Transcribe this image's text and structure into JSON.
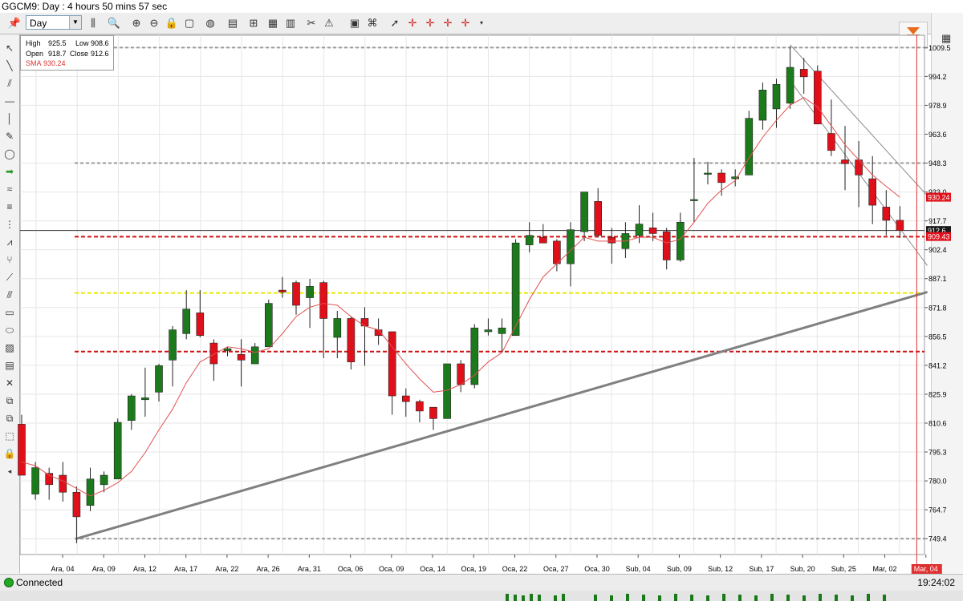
{
  "window": {
    "title": "GGCM9: Day : 4 hours 50 mins 57 sec"
  },
  "toolbar": {
    "period_value": "Day"
  },
  "info": {
    "high_label": "High",
    "high": "925.5",
    "low_label": "Low",
    "low": "908.6",
    "open_label": "Open",
    "open": "918.7",
    "close_label": "Close",
    "close": "912.6",
    "sma_label": "SMA",
    "sma": "930.24"
  },
  "status": {
    "connection": "Connected",
    "time": "19:24:02"
  },
  "colors": {
    "up": "#1c7a1c",
    "down": "#e0101a",
    "sma": "#e05050",
    "trendline": "#808080",
    "hline_yellow": "#e8e800",
    "hline_red": "#d01010"
  },
  "chart_data": {
    "type": "candlestick",
    "symbol": "GGCM9",
    "ylim": [
      741,
      1016
    ],
    "y_ticks": [
      "749.4",
      "764.7",
      "780.0",
      "795.3",
      "810.6",
      "825.9",
      "841.2",
      "856.5",
      "871.8",
      "887.1",
      "902.4",
      "917.7",
      "933.0",
      "948.3",
      "963.6",
      "978.9",
      "994.2",
      "1009.5"
    ],
    "x_labels": [
      "Ara, 04",
      "Ara, 09",
      "Ara, 12",
      "Ara, 17",
      "Ara, 22",
      "Ara, 26",
      "Ara, 31",
      "Oca, 06",
      "Oca, 09",
      "Oca, 14",
      "Oca, 19",
      "Oca, 22",
      "Oca, 27",
      "Oca, 30",
      "Sub, 04",
      "Sub, 09",
      "Sub, 12",
      "Sub, 17",
      "Sub, 20",
      "Sub, 25",
      "Mar, 02",
      "Mar, 04"
    ],
    "candles": [
      {
        "o": 810,
        "h": 815,
        "l": 783,
        "c": 783
      },
      {
        "o": 773,
        "h": 790,
        "l": 770,
        "c": 787
      },
      {
        "o": 784,
        "h": 787,
        "l": 770,
        "c": 778
      },
      {
        "o": 783,
        "h": 790,
        "l": 769,
        "c": 774
      },
      {
        "o": 774,
        "h": 777,
        "l": 747,
        "c": 761
      },
      {
        "o": 767,
        "h": 787,
        "l": 764,
        "c": 781
      },
      {
        "o": 778,
        "h": 785,
        "l": 774,
        "c": 783
      },
      {
        "o": 781,
        "h": 813,
        "l": 781,
        "c": 811
      },
      {
        "o": 812,
        "h": 826,
        "l": 807,
        "c": 825
      },
      {
        "o": 823,
        "h": 840,
        "l": 814,
        "c": 824
      },
      {
        "o": 827,
        "h": 842,
        "l": 822,
        "c": 841
      },
      {
        "o": 844,
        "h": 862,
        "l": 830,
        "c": 860
      },
      {
        "o": 858,
        "h": 881,
        "l": 855,
        "c": 871
      },
      {
        "o": 869,
        "h": 881,
        "l": 856,
        "c": 857
      },
      {
        "o": 853,
        "h": 855,
        "l": 833,
        "c": 842
      },
      {
        "o": 849,
        "h": 851,
        "l": 846,
        "c": 850
      },
      {
        "o": 847,
        "h": 855,
        "l": 830,
        "c": 844
      },
      {
        "o": 842,
        "h": 853,
        "l": 842,
        "c": 851
      },
      {
        "o": 851,
        "h": 876,
        "l": 851,
        "c": 874
      },
      {
        "o": 881,
        "h": 888,
        "l": 877,
        "c": 880
      },
      {
        "o": 885,
        "h": 886,
        "l": 868,
        "c": 873
      },
      {
        "o": 877,
        "h": 887,
        "l": 861,
        "c": 883
      },
      {
        "o": 885,
        "h": 886,
        "l": 845,
        "c": 866
      },
      {
        "o": 856,
        "h": 870,
        "l": 845,
        "c": 866
      },
      {
        "o": 866,
        "h": 867,
        "l": 839,
        "c": 843
      },
      {
        "o": 866,
        "h": 872,
        "l": 841,
        "c": 862
      },
      {
        "o": 860,
        "h": 866,
        "l": 852,
        "c": 857
      },
      {
        "o": 859,
        "h": 859,
        "l": 815,
        "c": 825
      },
      {
        "o": 825,
        "h": 829,
        "l": 814,
        "c": 822
      },
      {
        "o": 822,
        "h": 823,
        "l": 811,
        "c": 817
      },
      {
        "o": 819,
        "h": 819,
        "l": 807,
        "c": 813
      },
      {
        "o": 813,
        "h": 842,
        "l": 813,
        "c": 842
      },
      {
        "o": 842,
        "h": 844,
        "l": 827,
        "c": 831
      },
      {
        "o": 831,
        "h": 863,
        "l": 829,
        "c": 861
      },
      {
        "o": 859,
        "h": 866,
        "l": 857,
        "c": 860
      },
      {
        "o": 858,
        "h": 866,
        "l": 848,
        "c": 861
      },
      {
        "o": 857,
        "h": 908,
        "l": 857,
        "c": 906
      },
      {
        "o": 905,
        "h": 917,
        "l": 901,
        "c": 910
      },
      {
        "o": 909,
        "h": 916,
        "l": 906,
        "c": 906
      },
      {
        "o": 907,
        "h": 908,
        "l": 891,
        "c": 895
      },
      {
        "o": 895,
        "h": 917,
        "l": 883,
        "c": 913
      },
      {
        "o": 912,
        "h": 933,
        "l": 907,
        "c": 933
      },
      {
        "o": 928,
        "h": 935,
        "l": 909,
        "c": 910
      },
      {
        "o": 909,
        "h": 914,
        "l": 895,
        "c": 906
      },
      {
        "o": 903,
        "h": 917,
        "l": 898,
        "c": 911
      },
      {
        "o": 910,
        "h": 926,
        "l": 906,
        "c": 916
      },
      {
        "o": 914,
        "h": 922,
        "l": 907,
        "c": 911
      },
      {
        "o": 912,
        "h": 914,
        "l": 892,
        "c": 897
      },
      {
        "o": 897,
        "h": 922,
        "l": 896,
        "c": 917
      },
      {
        "o": 929,
        "h": 951,
        "l": 917,
        "c": 929
      },
      {
        "o": 943,
        "h": 949,
        "l": 937,
        "c": 943
      },
      {
        "o": 943,
        "h": 945,
        "l": 931,
        "c": 938
      },
      {
        "o": 940,
        "h": 945,
        "l": 936,
        "c": 941
      },
      {
        "o": 942,
        "h": 976,
        "l": 942,
        "c": 972
      },
      {
        "o": 971,
        "h": 991,
        "l": 966,
        "c": 987
      },
      {
        "o": 977,
        "h": 993,
        "l": 967,
        "c": 990
      },
      {
        "o": 980,
        "h": 1010,
        "l": 977,
        "c": 999
      },
      {
        "o": 998,
        "h": 1004,
        "l": 985,
        "c": 994
      },
      {
        "o": 997,
        "h": 1000,
        "l": 973,
        "c": 969
      },
      {
        "o": 964,
        "h": 982,
        "l": 952,
        "c": 955
      },
      {
        "o": 950,
        "h": 968,
        "l": 934,
        "c": 948
      },
      {
        "o": 950,
        "h": 960,
        "l": 925,
        "c": 942
      },
      {
        "o": 940,
        "h": 952,
        "l": 916,
        "c": 926
      },
      {
        "o": 925,
        "h": 934,
        "l": 910,
        "c": 918
      },
      {
        "o": 918,
        "h": 925.5,
        "l": 908.6,
        "c": 912.6
      }
    ],
    "sma": [
      790,
      788,
      783,
      780,
      776,
      772,
      775,
      779,
      785,
      795,
      807,
      818,
      832,
      843,
      847,
      851,
      850,
      848,
      850,
      858,
      867,
      872,
      874,
      873,
      867,
      862,
      860,
      851,
      842,
      834,
      827,
      828,
      831,
      836,
      843,
      848,
      862,
      876,
      888,
      895,
      902,
      909,
      907,
      907,
      907,
      909,
      909,
      906,
      908,
      917,
      927,
      934,
      939,
      951,
      962,
      971,
      979,
      983,
      978,
      968,
      958,
      950,
      942,
      936,
      930.24
    ],
    "hlines": [
      {
        "value": 1009.5,
        "style": "gray-dashed"
      },
      {
        "value": 948.3,
        "style": "gray-dashed"
      },
      {
        "value": 749.4,
        "style": "gray-dashed"
      },
      {
        "value": 879.5,
        "style": "yellow-dashed"
      },
      {
        "value": 848.5,
        "style": "red-dashed"
      },
      {
        "value": 909.3,
        "style": "red-dashed"
      },
      {
        "value": 912.6,
        "style": "dark-solid"
      }
    ],
    "trendlines": [
      {
        "from": [
          4,
          749.4
        ],
        "to": [
          66,
          880
        ],
        "style": "support"
      },
      {
        "from": [
          56,
          1011
        ],
        "to": [
          66,
          931
        ],
        "style": "channel"
      },
      {
        "from": [
          56,
          992
        ],
        "to": [
          66,
          894
        ],
        "style": "channel"
      }
    ],
    "price_tags": [
      {
        "text": "930.24",
        "value": 930.24,
        "bg": "#e0101a"
      },
      {
        "text": "912.6",
        "value": 912.6,
        "bg": "#1a1a1a"
      },
      {
        "text": "909.43",
        "value": 909.43,
        "bg": "#e0101a"
      }
    ]
  }
}
